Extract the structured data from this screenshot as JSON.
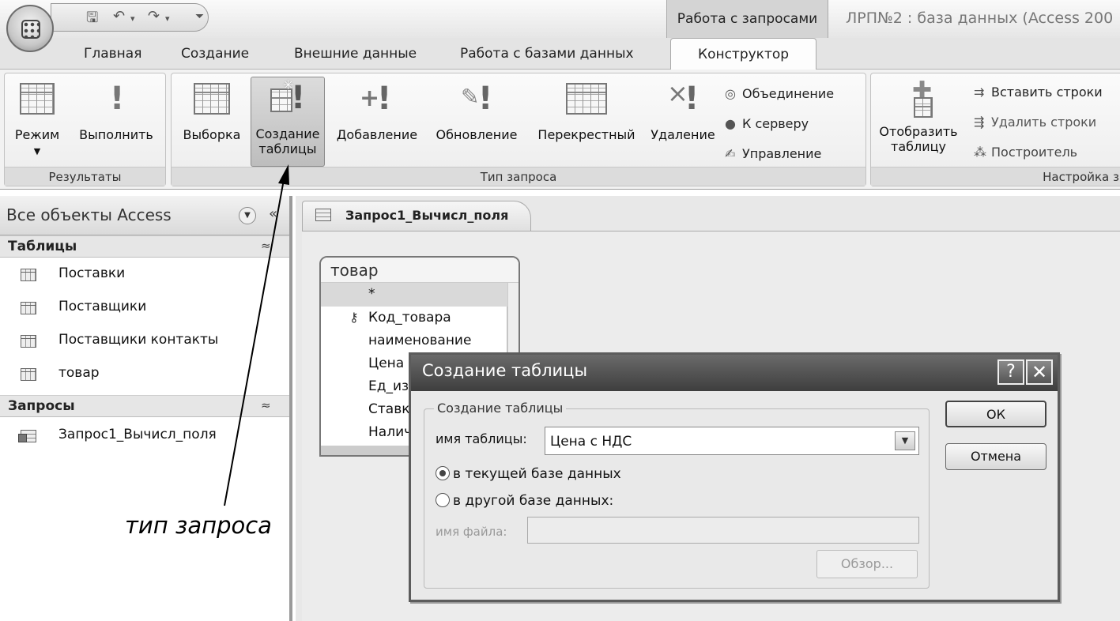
{
  "title_bar": {
    "context_tab": "Работа с запросами",
    "app_title": "ЛРП№2 : база данных (Access 200"
  },
  "tabs": [
    "Главная",
    "Создание",
    "Внешние данные",
    "Работа с базами данных",
    "Конструктор"
  ],
  "ribbon": {
    "results_group": {
      "label": "Результаты",
      "mode": "Режим",
      "run": "Выполнить"
    },
    "query_type_group": {
      "label": "Тип запроса",
      "select": "Выборка",
      "make_table_1": "Создание",
      "make_table_2": "таблицы",
      "append": "Добавление",
      "update": "Обновление",
      "crosstab": "Перекрестный",
      "delete": "Удаление",
      "union": "Объединение",
      "pass_through": "К серверу",
      "data_definition": "Управление"
    },
    "setup_group": {
      "label": "Настройка з",
      "show_table_1": "Отобразить",
      "show_table_2": "таблицу",
      "insert_rows": "Вставить строки",
      "delete_rows": "Удалить строки",
      "builder": "Построитель"
    }
  },
  "nav": {
    "header": "Все объекты Access",
    "tables_header": "Таблицы",
    "tables": [
      "Поставки",
      "Поставщики",
      "Поставщики контакты",
      "товар"
    ],
    "queries_header": "Запросы",
    "queries": [
      "Запрос1_Вычисл_поля"
    ]
  },
  "document": {
    "tab_label": "Запрос1_Вычисл_поля",
    "table_box": {
      "title": "товар",
      "fields": [
        "*",
        "Код_товара",
        "наименование",
        "Цена",
        "Ед_из",
        "Ставк",
        "Налич"
      ]
    }
  },
  "dialog": {
    "title": "Создание таблицы",
    "help": "?",
    "close": "✕",
    "group_legend": "Создание таблицы",
    "table_name_label": "имя таблицы:",
    "table_name_value": "Цена с НДС",
    "radio_current": "в текущей базе данных",
    "radio_other": "в другой базе данных:",
    "file_name_label": "имя файла:",
    "browse": "Обзор...",
    "ok": "ОК",
    "cancel": "Отмена"
  },
  "annotation": "тип запроса"
}
